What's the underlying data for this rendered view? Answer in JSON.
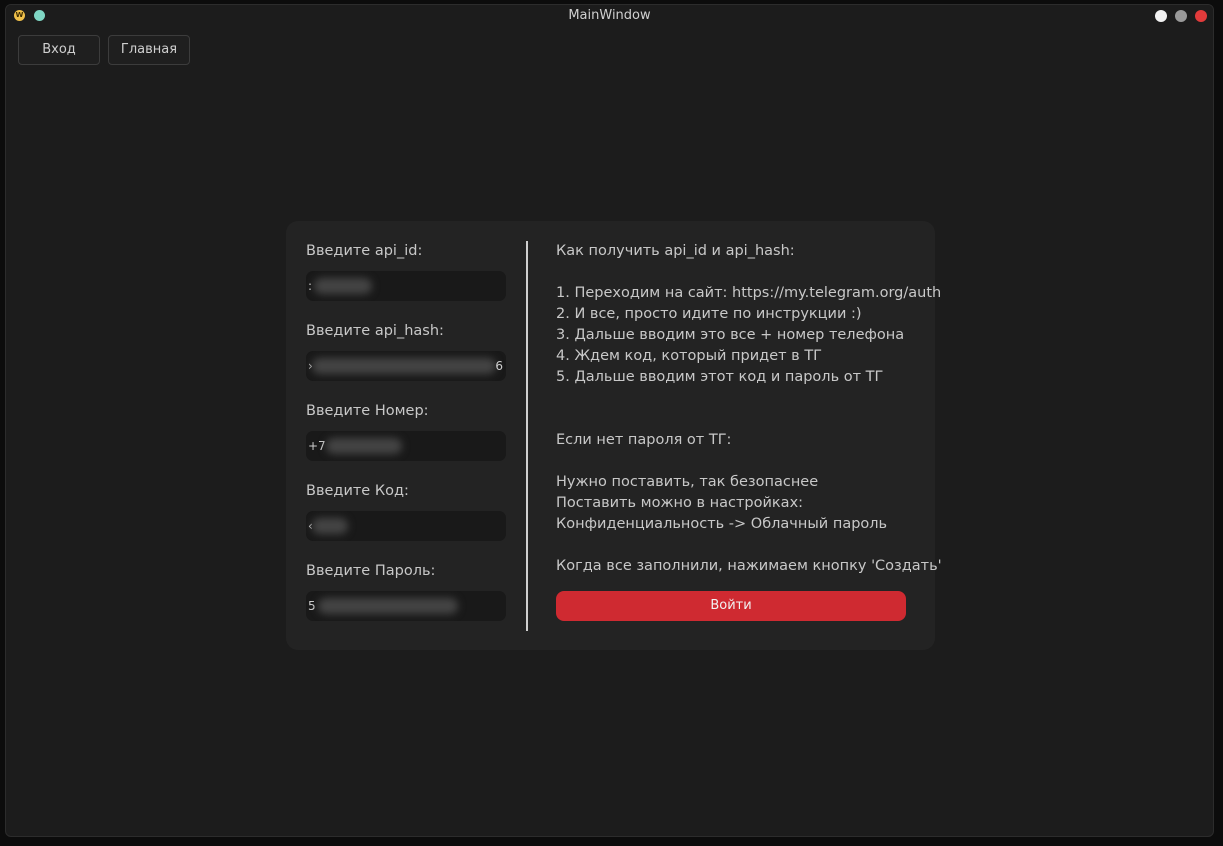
{
  "window": {
    "title": "MainWindow",
    "app_icon_glyph": "W",
    "controls": [
      "minimize-icon",
      "maximize-icon",
      "close-icon"
    ]
  },
  "toolbar": {
    "login_label": "Вход",
    "main_label": "Главная"
  },
  "form": {
    "api_id_label": "Введите api_id:",
    "api_id_value": ":",
    "api_hash_label": "Введите api_hash:",
    "api_hash_prefix": "›",
    "api_hash_suffix": "6",
    "phone_label": "Введите Номер:",
    "phone_value": "+7",
    "code_label": "Введите Код:",
    "code_value": "‹",
    "password_label": "Введите Пароль:",
    "password_value": "5"
  },
  "info": {
    "heading": "Как получить api_id и api_hash:",
    "step1": "1. Переходим на сайт: https://my.telegram.org/auth",
    "step2": "2. И все, просто идите по инструкции :)",
    "step3": "3. Дальше вводим это все + номер телефона",
    "step4": "4. Ждем код, который придет в ТГ",
    "step5": "5. Дальше вводим этот код и пароль от ТГ",
    "no_password_heading": "Если нет пароля от ТГ:",
    "tip1": "Нужно поставить, так безопаснее",
    "tip2": "Поставить можно в настройках:",
    "tip3": "Конфиденциальность -> Облачный пароль",
    "final": "Когда все заполнили, нажимаем кнопку 'Создать'"
  },
  "submit_label": "Войти",
  "colors": {
    "accent": "#cf2a31",
    "background": "#1c1c1c",
    "card": "#232323"
  }
}
